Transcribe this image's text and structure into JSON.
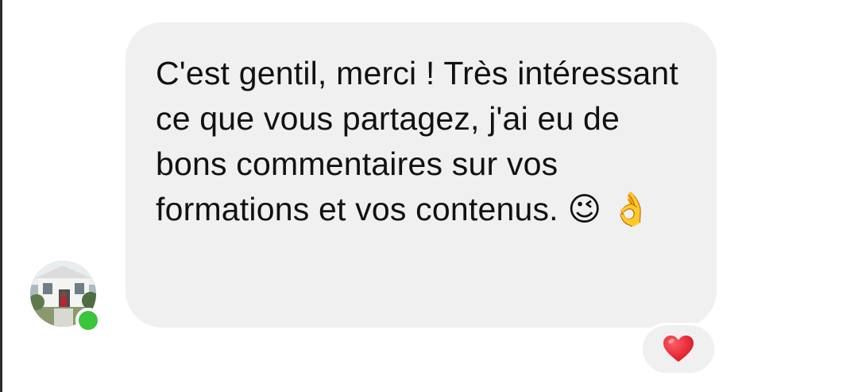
{
  "message": {
    "text": "C'est gentil, merci ! Très intéressant ce que vous partagez, j'ai eu de bons commentaires sur vos formations et vos contenus. 😉 👌",
    "sender_status": "online",
    "bubble_color": "#f0f0f0"
  },
  "reaction": {
    "emoji_icon": "heart-icon",
    "color": "#e0162b"
  },
  "avatar": {
    "icon": "profile-photo"
  },
  "status_color": "#3cc43c"
}
